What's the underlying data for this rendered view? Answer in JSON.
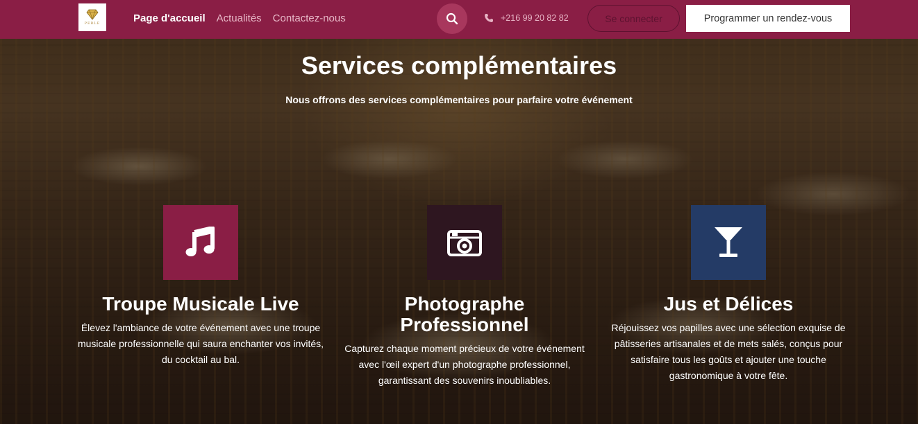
{
  "header": {
    "logo_text": "PERLE",
    "nav": [
      {
        "label": "Page d'accueil",
        "active": true
      },
      {
        "label": "Actualités",
        "active": false
      },
      {
        "label": "Contactez-nous",
        "active": false
      }
    ],
    "phone": "+216 99 20 82 82",
    "login_label": "Se connecter",
    "rdv_label": "Programmer un rendez-vous"
  },
  "section": {
    "title": "Services complémentaires",
    "subtitle": "Nous offrons des services complémentaires pour parfaire votre événement"
  },
  "services": [
    {
      "icon": "music-notes-icon",
      "color": "#8a1e45",
      "title": "Troupe Musicale Live",
      "description": "Élevez l'ambiance de votre événement avec une troupe musicale professionnelle qui saura enchanter vos invités, du cocktail au bal."
    },
    {
      "icon": "camera-icon",
      "color": "#2e1620",
      "title": "Photographe Professionnel",
      "description": "Capturez chaque moment précieux de votre événement avec l'œil expert d'un photographe professionnel, garantissant des souvenirs inoubliables."
    },
    {
      "icon": "cocktail-glass-icon",
      "color": "#243b66",
      "title": "Jus et Délices",
      "description": "Réjouissez vos papilles avec une sélection exquise de pâtisseries artisanales et de mets salés, conçus pour satisfaire tous les goûts et ajouter une touche gastronomique à votre fête."
    }
  ],
  "colors": {
    "brand": "#8a1e45",
    "search_bg": "#a8375d"
  }
}
